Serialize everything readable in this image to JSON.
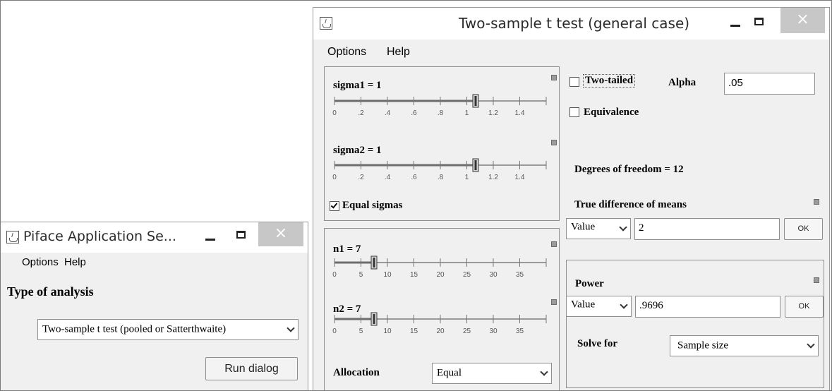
{
  "piface": {
    "title": "Piface Application Se...",
    "menu": [
      "Options",
      "Help"
    ],
    "type_label": "Type of analysis",
    "type_value": "Two-sample t test (pooled or Satterthwaite)",
    "run_button": "Run dialog",
    "close_glyph": "×"
  },
  "ttest": {
    "title": "Two-sample t test (general case)",
    "menu": [
      "Options",
      "Help"
    ],
    "close_glyph": "×",
    "sigma1": {
      "label": "sigma1 = 1",
      "value": 1,
      "min": 0,
      "max": 1.5,
      "ticks": [
        "0",
        ".2",
        ".4",
        ".6",
        ".8",
        "1",
        "1.2",
        "1.4"
      ]
    },
    "sigma2": {
      "label": "sigma2 = 1",
      "value": 1,
      "min": 0,
      "max": 1.5,
      "ticks": [
        "0",
        ".2",
        ".4",
        ".6",
        ".8",
        "1",
        "1.2",
        "1.4"
      ]
    },
    "equal_sigmas": {
      "label": "Equal sigmas",
      "checked": true
    },
    "n1": {
      "label": "n1 = 7",
      "value": 7,
      "min": 0,
      "max": 37.5,
      "ticks": [
        "0",
        "5",
        "10",
        "15",
        "20",
        "25",
        "30",
        "35"
      ]
    },
    "n2": {
      "label": "n2 = 7",
      "value": 7,
      "min": 0,
      "max": 37.5,
      "ticks": [
        "0",
        "5",
        "10",
        "15",
        "20",
        "25",
        "30",
        "35"
      ]
    },
    "allocation": {
      "label": "Allocation",
      "value": "Equal"
    },
    "two_tailed": {
      "label": "Two-tailed",
      "checked": false
    },
    "alpha": {
      "label": "Alpha",
      "value": ".05"
    },
    "equivalence": {
      "label": "Equivalence",
      "checked": false
    },
    "dof_text": "Degrees of freedom = 12",
    "true_diff": {
      "label": "True difference of means",
      "mode": "Value",
      "value": "2",
      "ok": "OK"
    },
    "power": {
      "label": "Power",
      "mode": "Value",
      "value": ".9696",
      "ok": "OK"
    },
    "solve_for": {
      "label": "Solve for",
      "value": "Sample size"
    }
  }
}
